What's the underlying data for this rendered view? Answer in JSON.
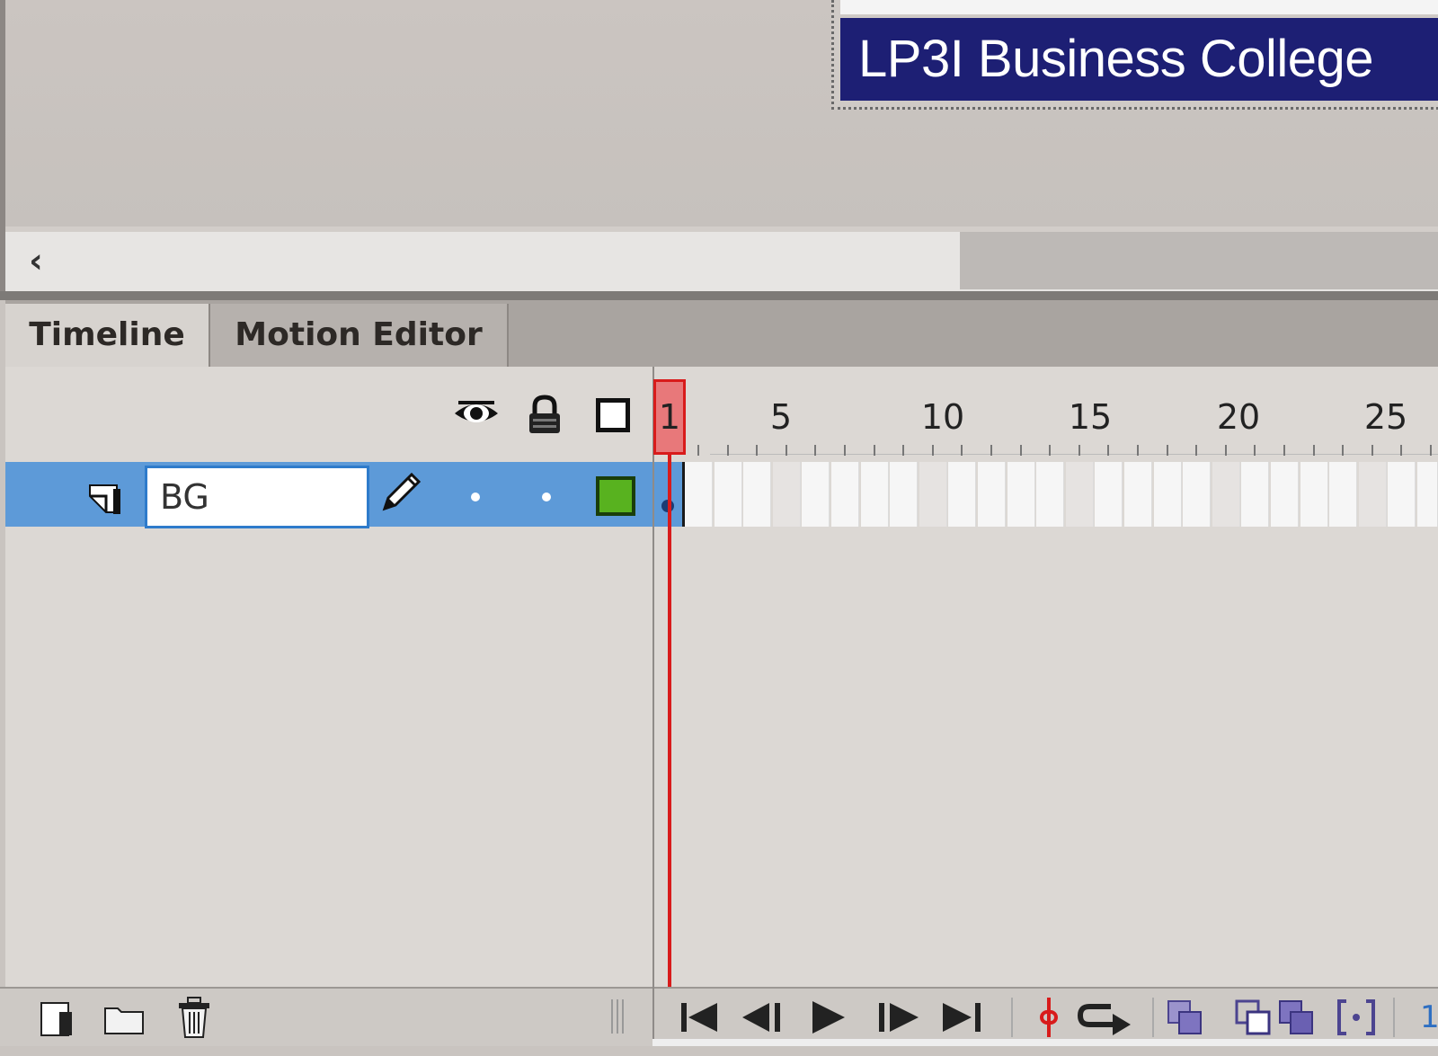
{
  "stage": {
    "banner_text": "LP3I Business College",
    "banner_color": "#1d1f74",
    "background_color": "#c9c4c0"
  },
  "scrollbar": {
    "left_arrow_icon": "chevron-left-icon",
    "left_arrow_glyph": "‹"
  },
  "tabs": [
    {
      "label": "Timeline",
      "active": true
    },
    {
      "label": "Motion Editor",
      "active": false
    }
  ],
  "layer_header": {
    "icons": [
      "eye-icon",
      "lock-icon",
      "outline-icon"
    ]
  },
  "ruler": {
    "current_frame": "1",
    "labels": [
      "5",
      "10",
      "15",
      "20",
      "25"
    ]
  },
  "layers": [
    {
      "name": "BG",
      "selected": true,
      "editing": true,
      "color": "#58b21f",
      "visible_dot": "•",
      "lock_dot": "•"
    }
  ],
  "playhead": {
    "frame": 1,
    "color": "#d81b1b"
  },
  "bottom_toolbar": {
    "layer_buttons": [
      "new-layer-icon",
      "new-folder-icon",
      "delete-icon"
    ],
    "playback_buttons": [
      "go-to-first-frame-icon",
      "step-back-icon",
      "play-icon",
      "step-forward-icon",
      "go-to-last-frame-icon"
    ],
    "frame_readout": "1"
  },
  "colors": {
    "selection_blue": "#5d9ad8",
    "input_border": "#2e7bcb",
    "tab_bar": "#a9a4a0"
  }
}
